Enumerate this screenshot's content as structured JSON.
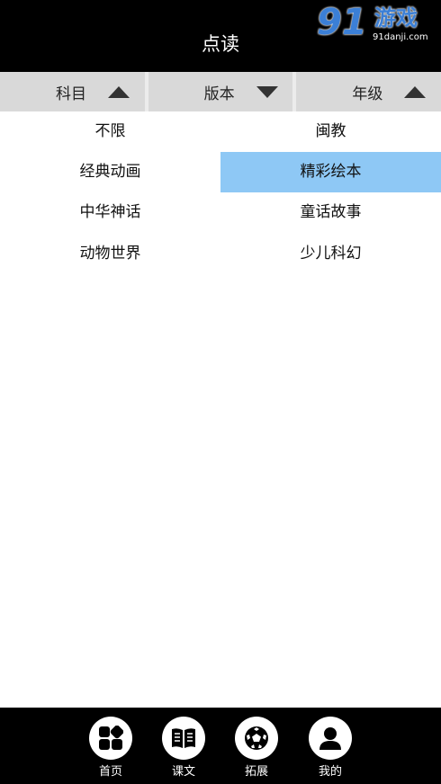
{
  "header": {
    "title": "点读",
    "watermark": {
      "number": "91",
      "brand": "游戏",
      "domain": "91danji.com"
    }
  },
  "filters": [
    {
      "label": "科目",
      "arrow": "up"
    },
    {
      "label": "版本",
      "arrow": "down"
    },
    {
      "label": "年级",
      "arrow": "up"
    }
  ],
  "options": [
    {
      "label": "不限",
      "selected": false
    },
    {
      "label": "闽教",
      "selected": false
    },
    {
      "label": "经典动画",
      "selected": false
    },
    {
      "label": "精彩绘本",
      "selected": true
    },
    {
      "label": "中华神话",
      "selected": false
    },
    {
      "label": "童话故事",
      "selected": false
    },
    {
      "label": "动物世界",
      "selected": false
    },
    {
      "label": "少儿科幻",
      "selected": false
    }
  ],
  "tabbar": {
    "items": [
      {
        "label": "首页",
        "icon": "grid-icon"
      },
      {
        "label": "课文",
        "icon": "book-icon"
      },
      {
        "label": "拓展",
        "icon": "soccer-ball-icon"
      },
      {
        "label": "我的",
        "icon": "user-icon"
      }
    ]
  },
  "colors": {
    "header_bg": "#000000",
    "filter_bar_bg": "#d9d9d9",
    "selected_bg": "#8ec8f5",
    "tabbar_bg": "#000000"
  }
}
